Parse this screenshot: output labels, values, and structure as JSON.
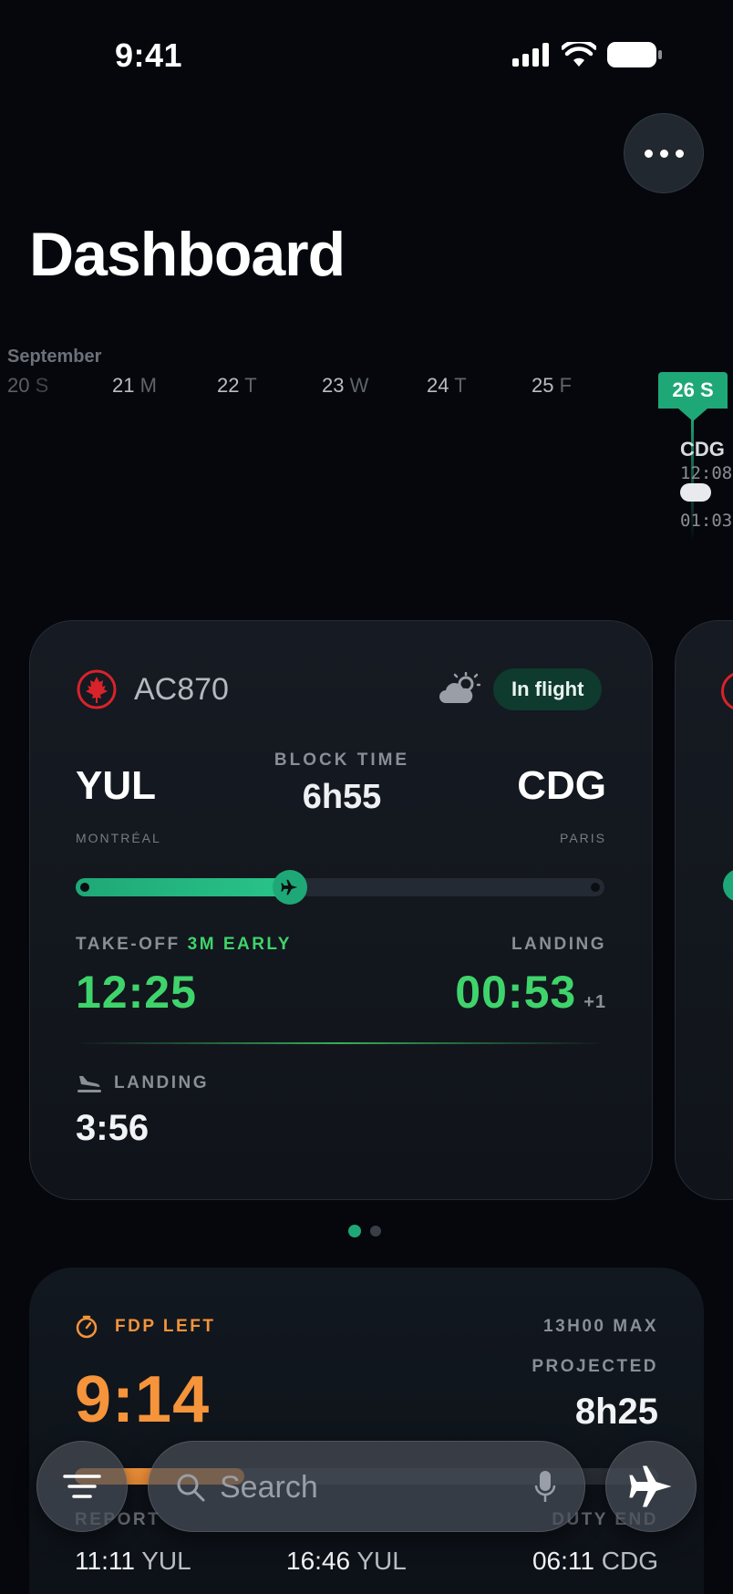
{
  "status_bar": {
    "time": "9:41"
  },
  "page": {
    "title": "Dashboard"
  },
  "calendar": {
    "month": "September",
    "days": [
      {
        "num": "20",
        "dow": "S",
        "faded": true
      },
      {
        "num": "21",
        "dow": "M"
      },
      {
        "num": "22",
        "dow": "T"
      },
      {
        "num": "23",
        "dow": "W"
      },
      {
        "num": "24",
        "dow": "T"
      },
      {
        "num": "25",
        "dow": "F"
      }
    ],
    "today": "26 S",
    "timeline": {
      "code": "CDG",
      "time_top": "12:08",
      "time_bottom": "01:03"
    }
  },
  "flight": {
    "number": "AC870",
    "status": "In flight",
    "weather_icon": "partly-cloudy-icon",
    "origin": {
      "code": "YUL",
      "city": "MONTRÉAL"
    },
    "destination": {
      "code": "CDG",
      "city": "PARIS"
    },
    "block_time_label": "BLOCK TIME",
    "block_time": "6h55",
    "progress": 0.405,
    "takeoff_label": "TAKE-OFF",
    "takeoff_note": "3M EARLY",
    "takeoff_time": "12:25",
    "landing_label": "LANDING",
    "landing_time": "00:53",
    "landing_day_offset": "+1",
    "footer_label": "LANDING",
    "footer_value": "3:56"
  },
  "pager": {
    "count": 2,
    "active": 0
  },
  "fdp": {
    "label": "FDP LEFT",
    "value": "9:14",
    "max": "13H00 MAX",
    "projected_label": "PROJECTED",
    "projected_value": "8h25",
    "progress": 0.29,
    "columns": [
      {
        "label": "REPORT",
        "time": "11:11",
        "code": "YUL"
      },
      {
        "label": "",
        "time": "16:46",
        "code": "YUL"
      },
      {
        "label": "DUTY END",
        "time": "06:11",
        "code": "CDG"
      }
    ]
  },
  "bottom_bar": {
    "search_placeholder": "Search",
    "left_icon": "list-menu-icon",
    "right_icon": "airplane-icon"
  },
  "colors": {
    "accent_green": "#1fa877",
    "time_green": "#3fd46b",
    "fdp_orange": "#f5943a",
    "airline_red": "#d8232a"
  }
}
